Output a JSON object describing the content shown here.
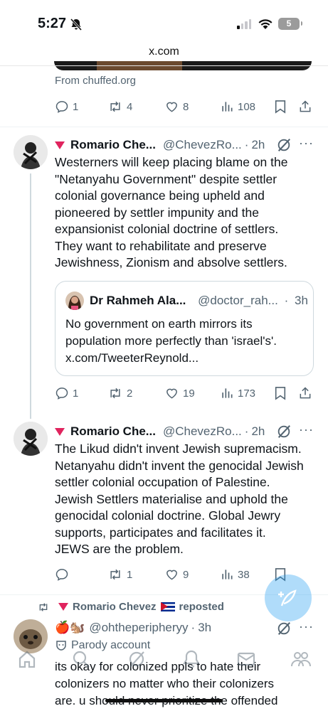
{
  "status_bar": {
    "time": "5:27",
    "battery": "5"
  },
  "browser": {
    "url": "x.com"
  },
  "prev_tweet": {
    "source": "From chuffed.org",
    "replies": "1",
    "reposts": "4",
    "likes": "8",
    "views": "108"
  },
  "tweet1": {
    "name": "Romario Che...",
    "handle": "@ChevezRo...",
    "dot": "·",
    "time": "2h",
    "more": "···",
    "text": "Westerners will keep placing blame on the\n\"Netanyahu Government\" despite settler\ncolonial governance being upheld and\npioneered by settler impunity and the\nexpansionist colonial doctrine of settlers.\nThey want to rehabilitate and preserve\nJewishness, Zionism and absolve settlers.",
    "quote": {
      "name": "Dr Rahmeh Ala...",
      "handle": "@doctor_rah...",
      "dot": "·",
      "time": "3h",
      "text": "No government on earth mirrors its\npopulation more perfectly than 'israel's'.\nx.com/TweeterReynold..."
    },
    "replies": "1",
    "reposts": "2",
    "likes": "19",
    "views": "173"
  },
  "tweet2": {
    "name": "Romario Che...",
    "handle": "@ChevezRo...",
    "dot": "·",
    "time": "2h",
    "more": "···",
    "text": "The Likud didn't invent Jewish supremacism.\nNetanyahu didn't invent the genocidal Jewish\nsettler colonial occupation of Palestine.\nJewish Settlers materialise and uphold the\ngenocidal colonial doctrine. Global Jewry\nsupports, participates and facilitates it.\nJEWS are the problem.",
    "replies": "",
    "reposts": "1",
    "likes": "9",
    "views": "38"
  },
  "tweet3": {
    "repost_name": "Romario Chevez",
    "repost_label": "reposted",
    "emojis": "🍎🐿️",
    "handle": "@ohtheperipheryy",
    "dot": "·",
    "time": "3h",
    "more": "···",
    "parody_label": "Parody account",
    "text": "its okay for colonized ppls to hate their\ncolonizers no matter who their colonizers\nare. u should never prioritize the offended"
  },
  "colors": {
    "accent": "#1d9bf0",
    "text": "#0f1419",
    "muted": "#536471",
    "flag_red": "#e0245e"
  }
}
